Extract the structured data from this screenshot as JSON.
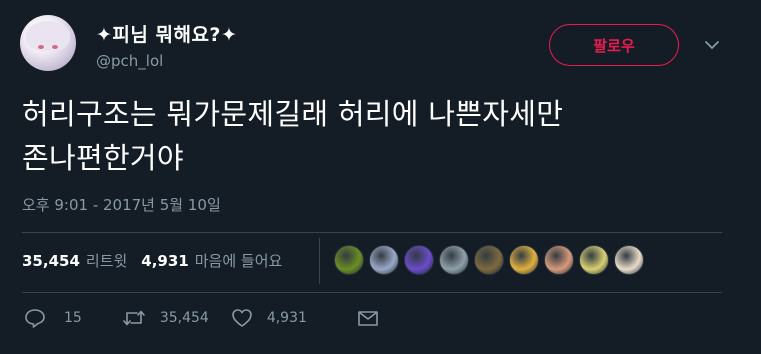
{
  "author": {
    "display_name": "✦피님 뭐해요?✦",
    "handle": "@pch_lol"
  },
  "follow_button": {
    "label": "팔로우"
  },
  "tweet": {
    "text_line1": "허리구조는 뭐가문제길래 허리에 나쁜자세만",
    "text_line2": "존나편한거야",
    "timestamp": "오후 9:01 - 2017년 5월 10일"
  },
  "stats": {
    "retweets_count": "35,454",
    "retweets_label": "리트윗",
    "likes_count": "4,931",
    "likes_label": "마음에 들어요"
  },
  "likers": [
    {
      "name": "liker-1",
      "color": "#6b8e23"
    },
    {
      "name": "liker-2",
      "color": "#9aa8c8"
    },
    {
      "name": "liker-3",
      "color": "#6a4cc9"
    },
    {
      "name": "liker-4",
      "color": "#8fa0a8"
    },
    {
      "name": "liker-5",
      "color": "#7c6a3e"
    },
    {
      "name": "liker-6",
      "color": "#e0b040"
    },
    {
      "name": "liker-7",
      "color": "#d79a7a"
    },
    {
      "name": "liker-8",
      "color": "#d8d070"
    },
    {
      "name": "liker-9",
      "color": "#e8dcc8"
    }
  ],
  "actions": {
    "reply_count": "15",
    "retweet_count": "35,454",
    "like_count": "4,931"
  },
  "colors": {
    "background": "#141d26",
    "accent": "#e81c4f",
    "muted": "#8899a6",
    "divider": "#38444d"
  }
}
